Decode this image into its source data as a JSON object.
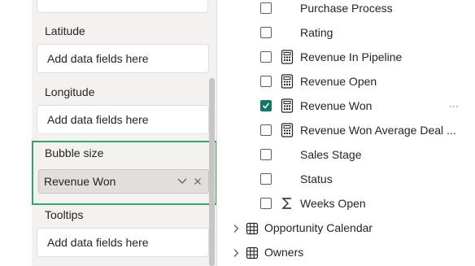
{
  "build_pane": {
    "wells": [
      {
        "label": "Latitude",
        "placeholder": "Add data fields here"
      },
      {
        "label": "Longitude",
        "placeholder": "Add data fields here"
      },
      {
        "label": "Bubble size",
        "field": "Revenue Won"
      },
      {
        "label": "Tooltips",
        "placeholder": "Add data fields here"
      }
    ]
  },
  "data_pane": {
    "fields": [
      {
        "name": "Purchase Process",
        "checked": false,
        "icon": "none"
      },
      {
        "name": "Rating",
        "checked": false,
        "icon": "none"
      },
      {
        "name": "Revenue In Pipeline",
        "checked": false,
        "icon": "calculator-icon"
      },
      {
        "name": "Revenue Open",
        "checked": false,
        "icon": "calculator-icon"
      },
      {
        "name": "Revenue Won",
        "checked": true,
        "icon": "calculator-icon",
        "more": "···"
      },
      {
        "name": "Revenue Won Average Deal ...",
        "checked": false,
        "icon": "calculator-icon"
      },
      {
        "name": "Sales Stage",
        "checked": false,
        "icon": "none"
      },
      {
        "name": "Status",
        "checked": false,
        "icon": "none"
      },
      {
        "name": "Weeks Open",
        "checked": false,
        "icon": "sigma-icon"
      }
    ],
    "tables": [
      {
        "name": "Opportunity Calendar",
        "icon": "table-icon"
      },
      {
        "name": "Owners",
        "icon": "table-icon"
      }
    ]
  },
  "colors": {
    "accent_highlight": "#31a765",
    "checkbox_checked": "#117865",
    "pane_background": "#f3f2f1"
  }
}
